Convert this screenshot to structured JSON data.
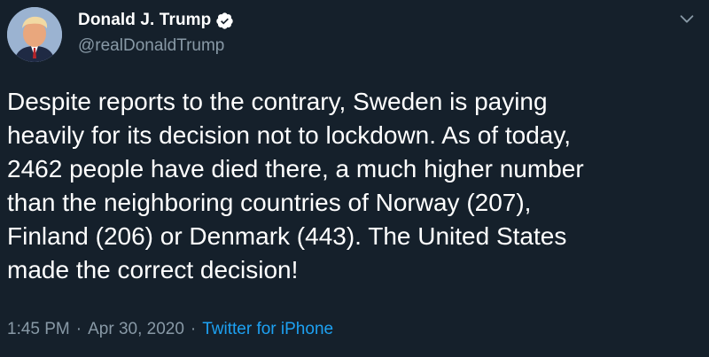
{
  "author": {
    "display_name": "Donald J. Trump",
    "handle": "@realDonaldTrump",
    "verified_icon": "verified-badge-icon"
  },
  "tweet": {
    "text_lines": [
      "Despite reports to the contrary, Sweden is paying",
      "heavily for its decision not to lockdown. As of today,",
      "2462 people have died there, a much higher number",
      "than the neighboring countries of Norway (207),",
      "Finland (206) or Denmark (443). The United States",
      "made the correct decision!"
    ]
  },
  "meta": {
    "time": "1:45 PM",
    "separator": "·",
    "date": "Apr 30, 2020",
    "source": "Twitter for iPhone"
  },
  "colors": {
    "background": "#15202b",
    "secondary_text": "#8899a6",
    "link": "#1da1f2"
  }
}
